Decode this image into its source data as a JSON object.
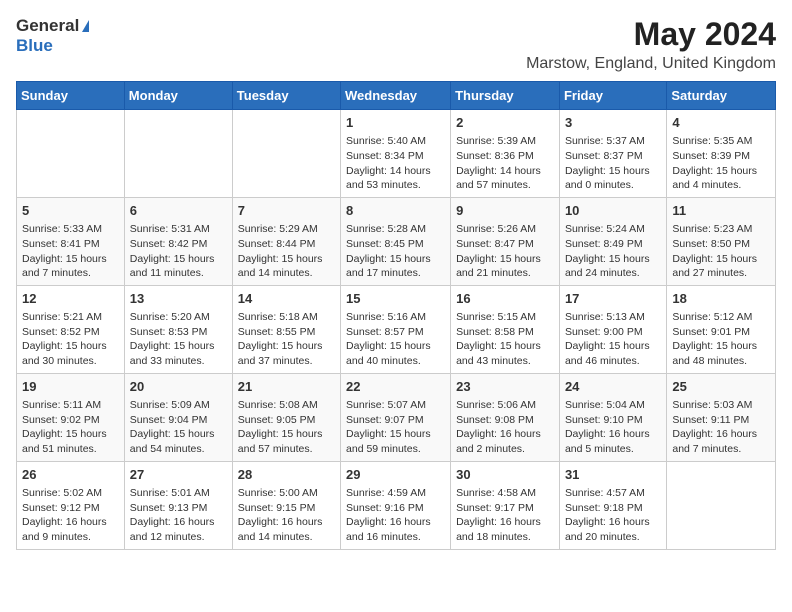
{
  "header": {
    "logo_general": "General",
    "logo_blue": "Blue",
    "month_title": "May 2024",
    "location": "Marstow, England, United Kingdom"
  },
  "weekdays": [
    "Sunday",
    "Monday",
    "Tuesday",
    "Wednesday",
    "Thursday",
    "Friday",
    "Saturday"
  ],
  "weeks": [
    [
      {
        "day": "",
        "info": ""
      },
      {
        "day": "",
        "info": ""
      },
      {
        "day": "",
        "info": ""
      },
      {
        "day": "1",
        "info": "Sunrise: 5:40 AM\nSunset: 8:34 PM\nDaylight: 14 hours and 53 minutes."
      },
      {
        "day": "2",
        "info": "Sunrise: 5:39 AM\nSunset: 8:36 PM\nDaylight: 14 hours and 57 minutes."
      },
      {
        "day": "3",
        "info": "Sunrise: 5:37 AM\nSunset: 8:37 PM\nDaylight: 15 hours and 0 minutes."
      },
      {
        "day": "4",
        "info": "Sunrise: 5:35 AM\nSunset: 8:39 PM\nDaylight: 15 hours and 4 minutes."
      }
    ],
    [
      {
        "day": "5",
        "info": "Sunrise: 5:33 AM\nSunset: 8:41 PM\nDaylight: 15 hours and 7 minutes."
      },
      {
        "day": "6",
        "info": "Sunrise: 5:31 AM\nSunset: 8:42 PM\nDaylight: 15 hours and 11 minutes."
      },
      {
        "day": "7",
        "info": "Sunrise: 5:29 AM\nSunset: 8:44 PM\nDaylight: 15 hours and 14 minutes."
      },
      {
        "day": "8",
        "info": "Sunrise: 5:28 AM\nSunset: 8:45 PM\nDaylight: 15 hours and 17 minutes."
      },
      {
        "day": "9",
        "info": "Sunrise: 5:26 AM\nSunset: 8:47 PM\nDaylight: 15 hours and 21 minutes."
      },
      {
        "day": "10",
        "info": "Sunrise: 5:24 AM\nSunset: 8:49 PM\nDaylight: 15 hours and 24 minutes."
      },
      {
        "day": "11",
        "info": "Sunrise: 5:23 AM\nSunset: 8:50 PM\nDaylight: 15 hours and 27 minutes."
      }
    ],
    [
      {
        "day": "12",
        "info": "Sunrise: 5:21 AM\nSunset: 8:52 PM\nDaylight: 15 hours and 30 minutes."
      },
      {
        "day": "13",
        "info": "Sunrise: 5:20 AM\nSunset: 8:53 PM\nDaylight: 15 hours and 33 minutes."
      },
      {
        "day": "14",
        "info": "Sunrise: 5:18 AM\nSunset: 8:55 PM\nDaylight: 15 hours and 37 minutes."
      },
      {
        "day": "15",
        "info": "Sunrise: 5:16 AM\nSunset: 8:57 PM\nDaylight: 15 hours and 40 minutes."
      },
      {
        "day": "16",
        "info": "Sunrise: 5:15 AM\nSunset: 8:58 PM\nDaylight: 15 hours and 43 minutes."
      },
      {
        "day": "17",
        "info": "Sunrise: 5:13 AM\nSunset: 9:00 PM\nDaylight: 15 hours and 46 minutes."
      },
      {
        "day": "18",
        "info": "Sunrise: 5:12 AM\nSunset: 9:01 PM\nDaylight: 15 hours and 48 minutes."
      }
    ],
    [
      {
        "day": "19",
        "info": "Sunrise: 5:11 AM\nSunset: 9:02 PM\nDaylight: 15 hours and 51 minutes."
      },
      {
        "day": "20",
        "info": "Sunrise: 5:09 AM\nSunset: 9:04 PM\nDaylight: 15 hours and 54 minutes."
      },
      {
        "day": "21",
        "info": "Sunrise: 5:08 AM\nSunset: 9:05 PM\nDaylight: 15 hours and 57 minutes."
      },
      {
        "day": "22",
        "info": "Sunrise: 5:07 AM\nSunset: 9:07 PM\nDaylight: 15 hours and 59 minutes."
      },
      {
        "day": "23",
        "info": "Sunrise: 5:06 AM\nSunset: 9:08 PM\nDaylight: 16 hours and 2 minutes."
      },
      {
        "day": "24",
        "info": "Sunrise: 5:04 AM\nSunset: 9:10 PM\nDaylight: 16 hours and 5 minutes."
      },
      {
        "day": "25",
        "info": "Sunrise: 5:03 AM\nSunset: 9:11 PM\nDaylight: 16 hours and 7 minutes."
      }
    ],
    [
      {
        "day": "26",
        "info": "Sunrise: 5:02 AM\nSunset: 9:12 PM\nDaylight: 16 hours and 9 minutes."
      },
      {
        "day": "27",
        "info": "Sunrise: 5:01 AM\nSunset: 9:13 PM\nDaylight: 16 hours and 12 minutes."
      },
      {
        "day": "28",
        "info": "Sunrise: 5:00 AM\nSunset: 9:15 PM\nDaylight: 16 hours and 14 minutes."
      },
      {
        "day": "29",
        "info": "Sunrise: 4:59 AM\nSunset: 9:16 PM\nDaylight: 16 hours and 16 minutes."
      },
      {
        "day": "30",
        "info": "Sunrise: 4:58 AM\nSunset: 9:17 PM\nDaylight: 16 hours and 18 minutes."
      },
      {
        "day": "31",
        "info": "Sunrise: 4:57 AM\nSunset: 9:18 PM\nDaylight: 16 hours and 20 minutes."
      },
      {
        "day": "",
        "info": ""
      }
    ]
  ]
}
